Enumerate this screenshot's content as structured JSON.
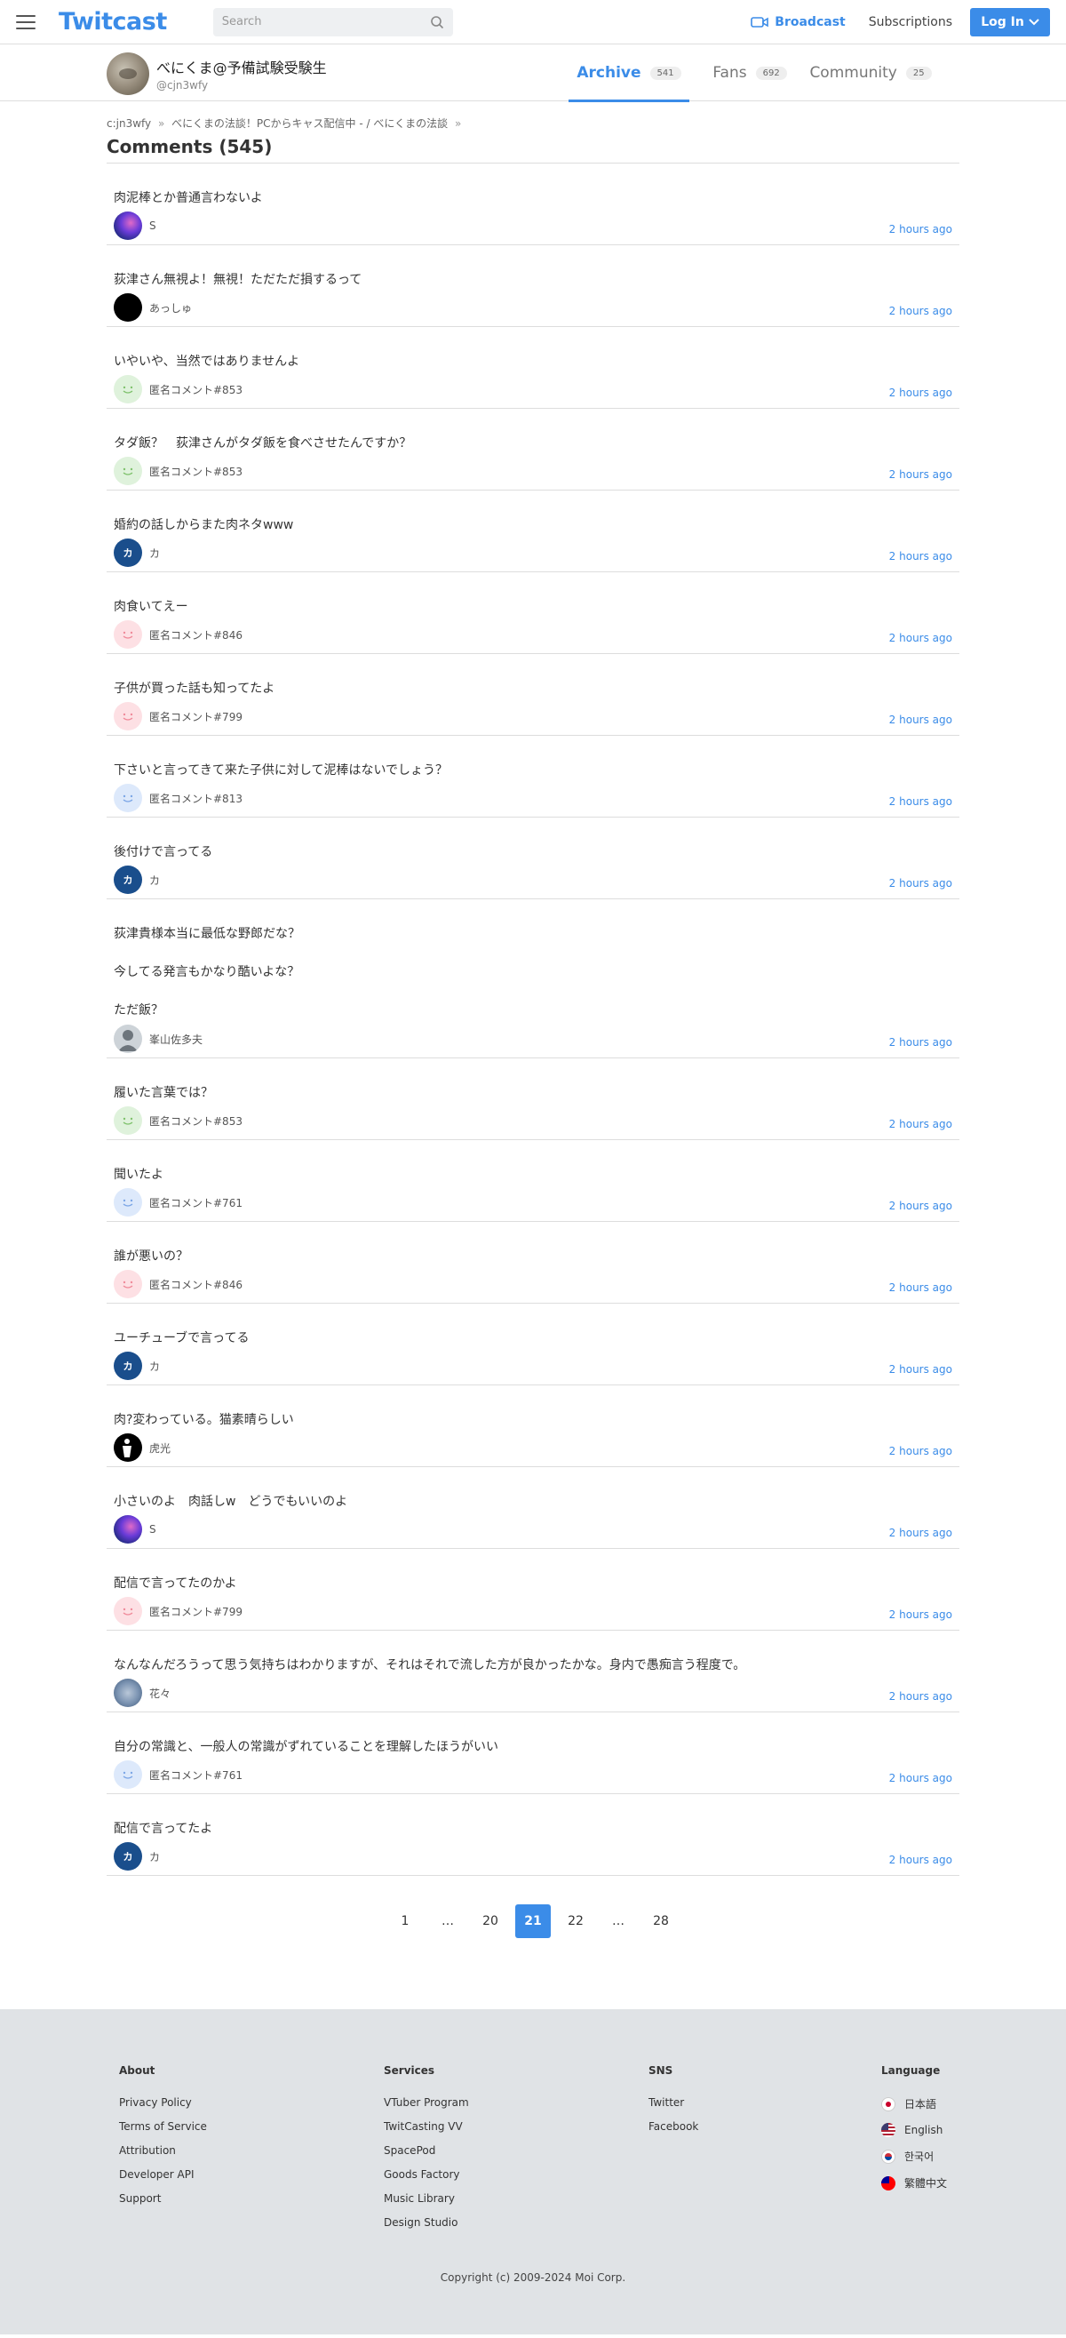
{
  "header": {
    "logo": "Twitcast",
    "search_placeholder": "Search",
    "broadcast": "Broadcast",
    "subscriptions": "Subscriptions",
    "login": "Log In"
  },
  "profile": {
    "name": "べにくま@予備試験受験生",
    "handle": "@cjn3wfy",
    "tabs": [
      {
        "label": "Archive",
        "count": "541"
      },
      {
        "label": "Fans",
        "count": "692"
      },
      {
        "label": "Community",
        "count": "25"
      }
    ]
  },
  "breadcrumb": {
    "item1": "c:jn3wfy",
    "item2": "べにくまの法談！PCからキャス配信中 - / べにくまの法談",
    "sep": "»"
  },
  "comments_title": "Comments (545)",
  "comments": [
    {
      "text": "肉泥棒とか普通言わないよ",
      "user": "S",
      "time": "2 hours ago"
    },
    {
      "text": "荻津さん無視よ！無視！ただただ損するって",
      "user": "あっしゅ",
      "time": "2 hours ago"
    },
    {
      "text": "いやいや、当然ではありませんよ",
      "user": "匿名コメント#853",
      "time": "2 hours ago"
    },
    {
      "text": "タダ飯？　荻津さんがタダ飯を食べさせたんですか？",
      "user": "匿名コメント#853",
      "time": "2 hours ago"
    },
    {
      "text": "婚約の話しからまた肉ネタwww",
      "user": "カ",
      "time": "2 hours ago"
    },
    {
      "text": "肉食いてえー",
      "user": "匿名コメント#846",
      "time": "2 hours ago"
    },
    {
      "text": "子供が買った話も知ってたよ",
      "user": "匿名コメント#799",
      "time": "2 hours ago"
    },
    {
      "text": "下さいと言ってきて来た子供に対して泥棒はないでしょう？",
      "user": "匿名コメント#813",
      "time": "2 hours ago"
    },
    {
      "text": "後付けで言ってる",
      "user": "カ",
      "time": "2 hours ago"
    },
    {
      "text": "荻津貴様本当に最低な野郎だな？\n今してる発言もかなり酷いよな？\nただ飯？",
      "user": "峯山佐多夫",
      "time": "2 hours ago"
    },
    {
      "text": "履いた言葉では？",
      "user": "匿名コメント#853",
      "time": "2 hours ago"
    },
    {
      "text": "聞いたよ",
      "user": "匿名コメント#761",
      "time": "2 hours ago"
    },
    {
      "text": "誰が悪いの？",
      "user": "匿名コメント#846",
      "time": "2 hours ago"
    },
    {
      "text": "ユーチューブで言ってる",
      "user": "カ",
      "time": "2 hours ago"
    },
    {
      "text": "肉?変わっている。猫素晴らしい",
      "user": "虎光",
      "time": "2 hours ago"
    },
    {
      "text": "小さいのよ　肉話しw　どうでもいいのよ",
      "user": "S",
      "time": "2 hours ago"
    },
    {
      "text": "配信で言ってたのかよ",
      "user": "匿名コメント#799",
      "time": "2 hours ago"
    },
    {
      "text": "なんなんだろうって思う気持ちはわかりますが、それはそれで流した方が良かったかな。身内で愚痴言う程度で。",
      "user": "花々",
      "time": "2 hours ago"
    },
    {
      "text": "自分の常識と、一般人の常識がずれていることを理解したほうがいい",
      "user": "匿名コメント#761",
      "time": "2 hours ago"
    },
    {
      "text": "配信で言ってたよ",
      "user": "カ",
      "time": "2 hours ago"
    }
  ],
  "avatar_labels": {
    "ka": "カ"
  },
  "pagination": [
    "1",
    "…",
    "20",
    "21",
    "22",
    "…",
    "28"
  ],
  "pagination_active": "21",
  "footer": {
    "about": {
      "title": "About",
      "links": [
        "Privacy Policy",
        "Terms of Service",
        "Attribution",
        "Developer API",
        "Support"
      ]
    },
    "services": {
      "title": "Services",
      "links": [
        "VTuber Program",
        "TwitCasting VV",
        "SpacePod",
        "Goods Factory",
        "Music Library",
        "Design Studio"
      ]
    },
    "sns": {
      "title": "SNS",
      "links": [
        "Twitter",
        "Facebook"
      ]
    },
    "language": {
      "title": "Language",
      "links": [
        "日本語",
        "English",
        "한국어",
        "繁體中文"
      ]
    },
    "copyright": "Copyright (c) 2009-2024 Moi Corp."
  },
  "colors": {
    "accent": "#3b8ce8",
    "footer_bg": "#e0e3e6"
  }
}
